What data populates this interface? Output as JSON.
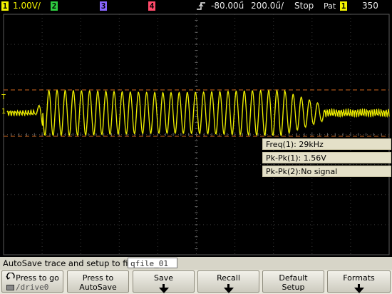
{
  "status": {
    "ch1_num": "1",
    "ch1_scale": "1.00V/",
    "ch2_num": "2",
    "ch3_num": "3",
    "ch4_num": "4",
    "trigger_icon": "trigger-edge-icon",
    "time_offset": "-80.00ű",
    "time_scale": "200.0ű/",
    "run_state": "Stop",
    "trigger_label": "Pat",
    "trigger_src": "1",
    "trigger_level": "350 ",
    "colors": {
      "ch1": "#f5f500",
      "ch2": "#2ecc40",
      "ch3": "#8866ff",
      "ch4": "#ff4a6a"
    }
  },
  "markers": {
    "trigger_level_marker": "T",
    "ch1_ground_marker": "1"
  },
  "measurements": [
    "Freq(1): 29kHz",
    "Pk-Pk(1): 1.56V",
    "Pk-Pk(2):No signal"
  ],
  "autosave": {
    "label": "AutoSave trace and setup to file:",
    "filename": "qfile_01"
  },
  "softkeys": [
    {
      "line1": "Press to go",
      "line2": "/drive0",
      "icon": "rotate-knob-icon"
    },
    {
      "line1": "Press to",
      "line2": "AutoSave"
    },
    {
      "line1": "Save",
      "arrow": true
    },
    {
      "line1": "Recall",
      "arrow": true
    },
    {
      "line1": "Default",
      "line2": "Setup"
    },
    {
      "line1": "Formats",
      "arrow": true
    }
  ]
}
